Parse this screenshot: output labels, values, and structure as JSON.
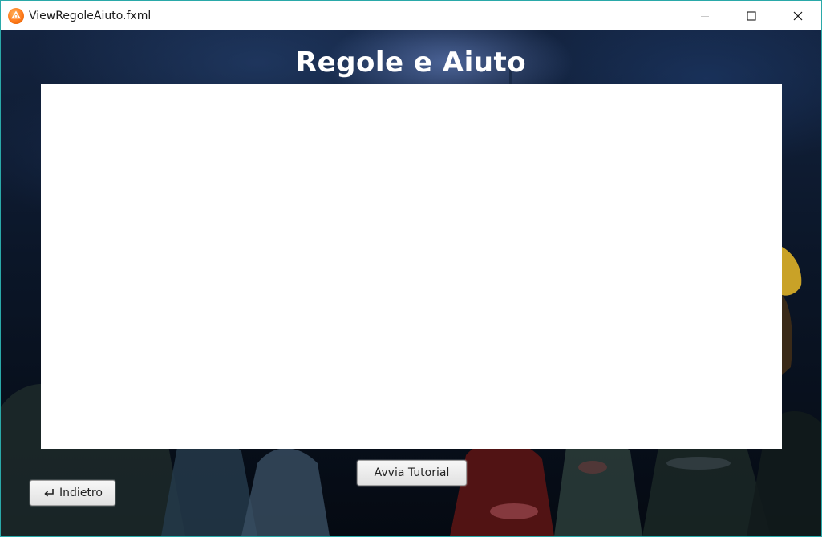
{
  "window": {
    "title": "ViewRegoleAiuto.fxml",
    "icon": "app-icon",
    "controls": [
      "minimize-icon",
      "maximize-icon",
      "close-icon"
    ]
  },
  "page": {
    "heading": "Regole e Aiuto",
    "content_text": ""
  },
  "buttons": {
    "tutorial_label": "Avvia Tutorial",
    "back_label": "Indietro",
    "back_icon": "return-arrow-icon"
  },
  "colors": {
    "window_border": "#2aa9a9",
    "heading": "#ffffff",
    "panel": "#ffffff",
    "app_icon": "#ff7a1a"
  }
}
